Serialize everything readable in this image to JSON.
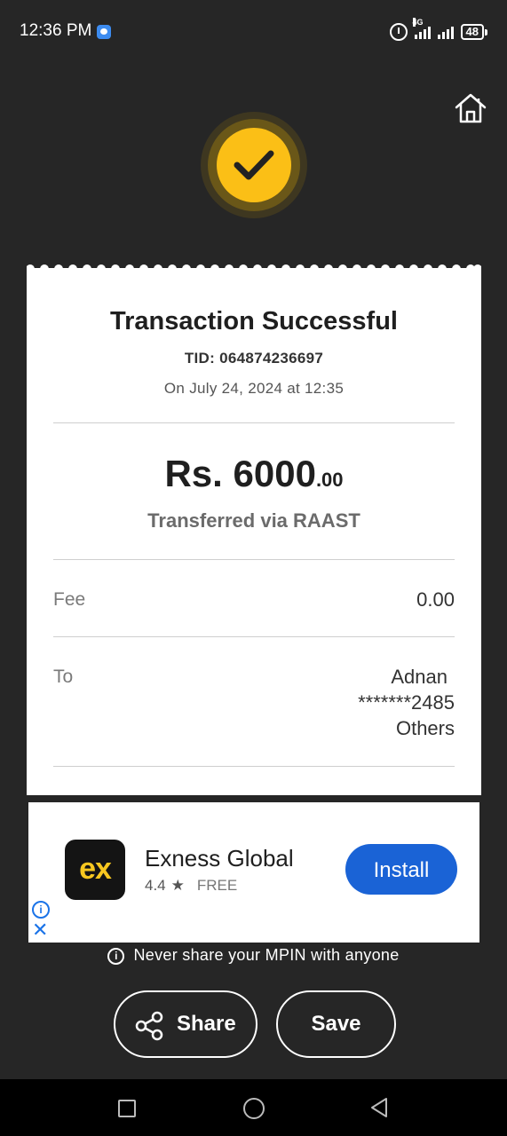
{
  "status_bar": {
    "time": "12:36 PM",
    "network": "4G",
    "battery": "48"
  },
  "receipt": {
    "title": "Transaction Successful",
    "tid": "TID: 064874236697",
    "date": "On July 24, 2024 at 12:35",
    "amount_main": "Rs. 6000",
    "amount_decimal": ".00",
    "via": "Transferred via RAAST",
    "fee_label": "Fee",
    "fee_value": "0.00",
    "to_label": "To",
    "to_name": "Adnan",
    "to_account": "*******2485",
    "to_bank": "Others"
  },
  "ad": {
    "logo_text": "ex",
    "app_name": "Exness Global",
    "rating": "4.4",
    "star": "★",
    "price": "FREE",
    "install_label": "Install",
    "info_icon": "i",
    "close_icon": "✕"
  },
  "notice": {
    "icon": "i",
    "text": "Never share your MPIN with anyone"
  },
  "actions": {
    "share_label": "Share",
    "save_label": "Save"
  },
  "colors": {
    "background": "#262626",
    "accent": "#fbbf16",
    "install": "#1a63d6"
  }
}
